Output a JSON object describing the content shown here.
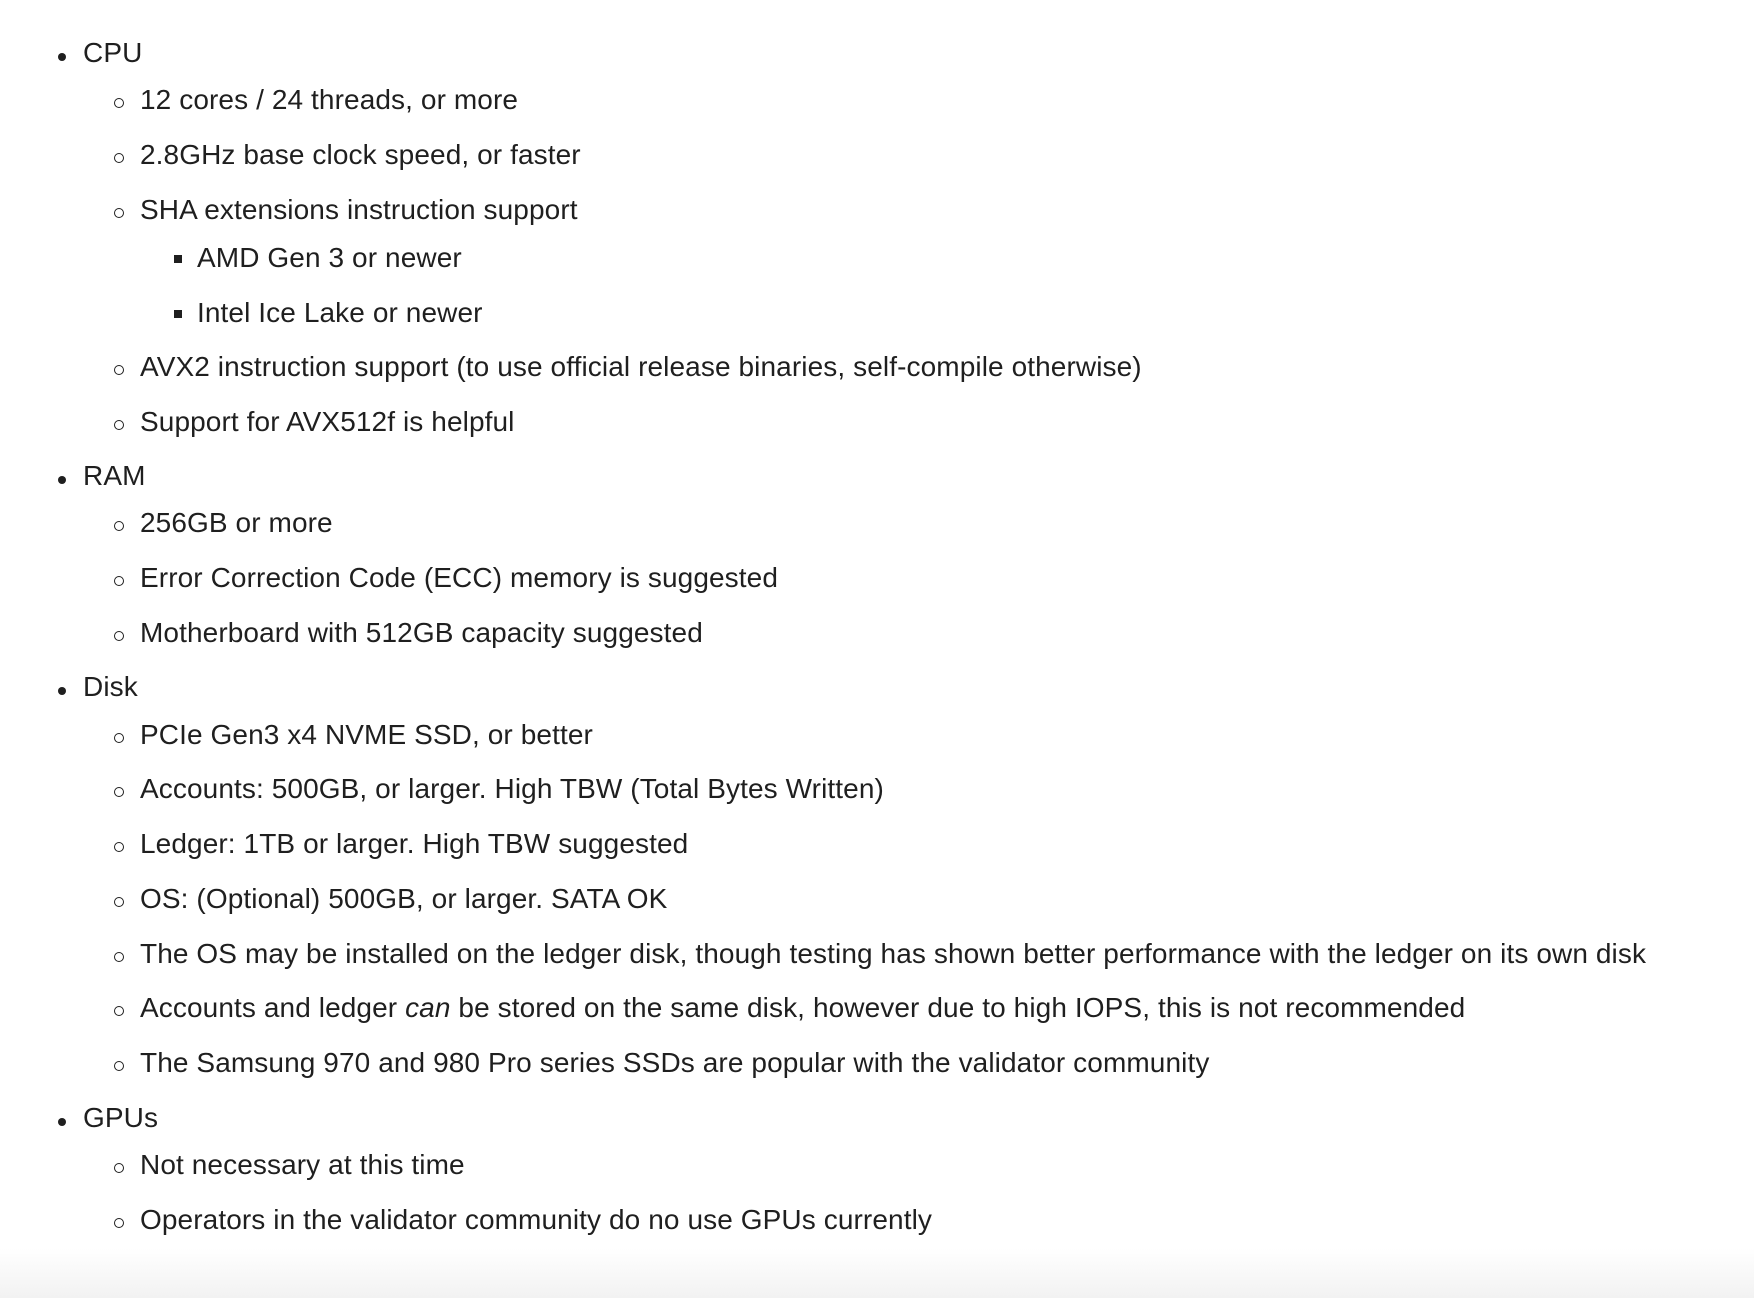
{
  "sections": [
    {
      "label": "CPU",
      "items": [
        {
          "text": "12 cores / 24 threads, or more"
        },
        {
          "text": "2.8GHz base clock speed, or faster"
        },
        {
          "text": "SHA extensions instruction support",
          "sub": [
            "AMD Gen 3 or newer",
            "Intel Ice Lake or newer"
          ]
        },
        {
          "text": "AVX2 instruction support (to use official release binaries, self-compile otherwise)"
        },
        {
          "text": "Support for AVX512f is helpful"
        }
      ]
    },
    {
      "label": "RAM",
      "items": [
        {
          "text": "256GB or more"
        },
        {
          "text": "Error Correction Code (ECC) memory is suggested"
        },
        {
          "text": "Motherboard with 512GB capacity suggested"
        }
      ]
    },
    {
      "label": "Disk",
      "items": [
        {
          "text": "PCIe Gen3 x4 NVME SSD, or better"
        },
        {
          "text": "Accounts: 500GB, or larger. High TBW (Total Bytes Written)"
        },
        {
          "text": "Ledger: 1TB or larger. High TBW suggested"
        },
        {
          "text": "OS: (Optional) 500GB, or larger. SATA OK"
        },
        {
          "text": "The OS may be installed on the ledger disk, though testing has shown better performance with the ledger on its own disk"
        },
        {
          "text_before": "Accounts and ledger ",
          "text_em": "can",
          "text_after": " be stored on the same disk, however due to high IOPS, this is not recommended"
        },
        {
          "text": "The Samsung 970 and 980 Pro series SSDs are popular with the validator community"
        }
      ]
    },
    {
      "label": "GPUs",
      "items": [
        {
          "text": "Not necessary at this time"
        },
        {
          "text": "Operators in the validator community do no use GPUs currently"
        }
      ]
    }
  ]
}
